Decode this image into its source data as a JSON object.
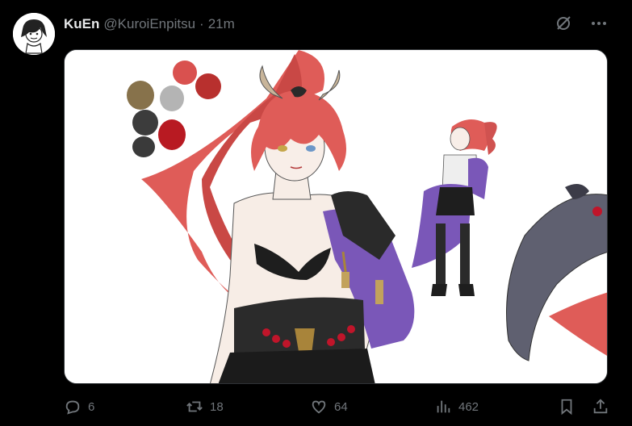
{
  "tweet": {
    "display_name": "KuEn",
    "handle": "@KuroiEnpitsu",
    "separator": "·",
    "time": "21m"
  },
  "icons": {
    "grok": "grok-icon",
    "more": "more-icon"
  },
  "colors": {
    "background": "#000000",
    "text_primary": "#e7e9ea",
    "text_secondary": "#71767b",
    "hair_red": "#e0605d",
    "outfit_purple": "#7a57b8"
  },
  "actions": {
    "replies": "6",
    "reposts": "18",
    "likes": "64",
    "views": "462"
  }
}
